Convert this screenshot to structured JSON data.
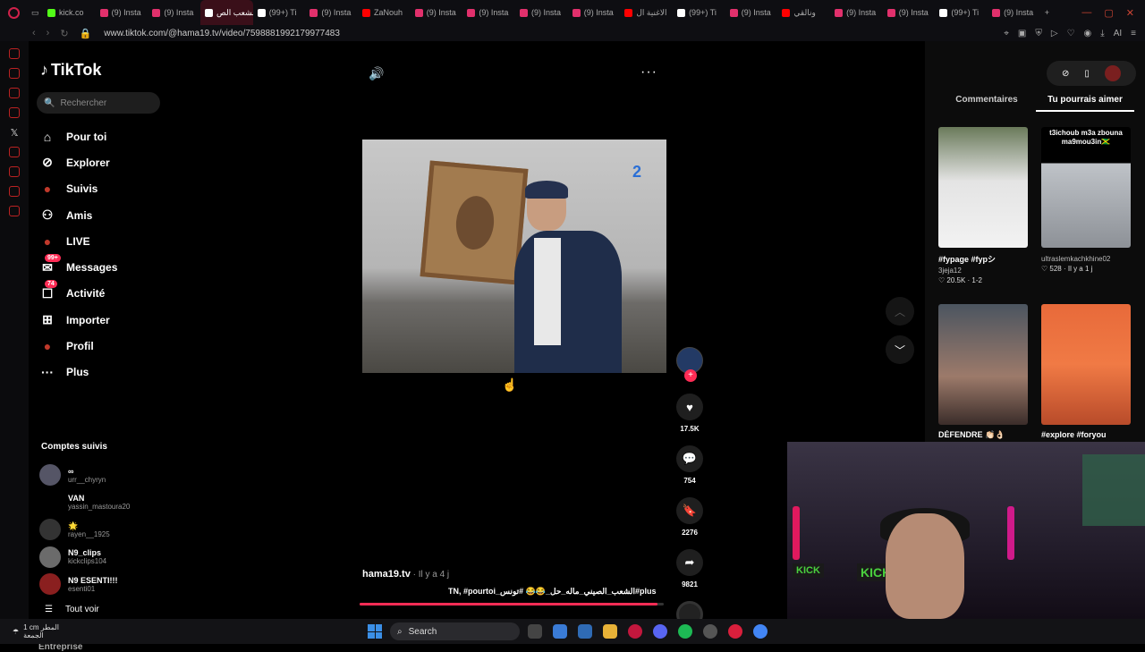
{
  "browser": {
    "tabs": [
      {
        "label": "kick.co",
        "color": "#53fc18"
      },
      {
        "label": "(9) Insta",
        "color": "#e1306c"
      },
      {
        "label": "(9) Insta",
        "color": "#e1306c"
      },
      {
        "label": "الشعب الص",
        "color": "#ffffff",
        "active": true
      },
      {
        "label": "(99+) Ti",
        "color": "#ffffff"
      },
      {
        "label": "(9) Insta",
        "color": "#e1306c"
      },
      {
        "label": "ZaNouh",
        "color": "#ff0000"
      },
      {
        "label": "(9) Insta",
        "color": "#e1306c"
      },
      {
        "label": "(9) Insta",
        "color": "#e1306c"
      },
      {
        "label": "(9) Insta",
        "color": "#e1306c"
      },
      {
        "label": "(9) Insta",
        "color": "#e1306c"
      },
      {
        "label": "الاغنية ال",
        "color": "#ff0000"
      },
      {
        "label": "(99+) Ti",
        "color": "#ffffff"
      },
      {
        "label": "(9) Insta",
        "color": "#e1306c"
      },
      {
        "label": "ونالقي",
        "color": "#ff0000"
      },
      {
        "label": "(9) Insta",
        "color": "#e1306c"
      },
      {
        "label": "(9) Insta",
        "color": "#e1306c"
      },
      {
        "label": "(99+) Ti",
        "color": "#ffffff"
      },
      {
        "label": "(9) Insta",
        "color": "#e1306c"
      }
    ],
    "url": "www.tiktok.com/@hama19.tv/video/7598881992179977483",
    "ai_label": "AI"
  },
  "tiktok": {
    "logo_text": "TikTok",
    "search_placeholder": "Rechercher",
    "menu": [
      {
        "label": "Pour toi",
        "icon": "home-icon"
      },
      {
        "label": "Explorer",
        "icon": "compass-icon"
      },
      {
        "label": "Suivis",
        "icon": "following-icon"
      },
      {
        "label": "Amis",
        "icon": "friends-icon"
      },
      {
        "label": "LIVE",
        "icon": "live-icon"
      },
      {
        "label": "Messages",
        "icon": "messages-icon",
        "badge": "99+"
      },
      {
        "label": "Activité",
        "icon": "activity-icon",
        "badge": "74"
      },
      {
        "label": "Importer",
        "icon": "upload-icon"
      },
      {
        "label": "Profil",
        "icon": "profile-icon"
      },
      {
        "label": "Plus",
        "icon": "more-icon"
      }
    ],
    "following_title": "Comptes suivis",
    "following": [
      {
        "name": "∞",
        "handle": "urr__chyryn"
      },
      {
        "name": "VAN",
        "handle": "yassin_mastoura20"
      },
      {
        "name": "🌟",
        "handle": "rayen__1925"
      },
      {
        "name": "N9_clips",
        "handle": "kickclips104"
      },
      {
        "name": "N9 ESENTI!!!",
        "handle": "esenti01"
      }
    ],
    "see_all": "Tout voir",
    "entreprise": "Entreprise",
    "video": {
      "author": "hama19.tv",
      "time": " · Il y a 4 j",
      "caption": "#الشعب_الصيني_ماله_حل_😂😂 #تونس_TN, #pourtoi",
      "more": "plus",
      "progress": 0.98,
      "likes": "17.5K",
      "comments": "754",
      "saves": "2276",
      "shares": "9821"
    },
    "panel": {
      "tabs": [
        "Commentaires",
        "Tu pourrais aimer"
      ],
      "active_tab": 1,
      "cards": [
        {
          "title": "#fypage #fypシ",
          "user": "3jeja12",
          "likes": "20.5K · 1-2",
          "overlay": ""
        },
        {
          "title": "",
          "user": "ultraslemkachkhine02",
          "likes": "528 · Il y a 1 j",
          "overlay": "t3ichoub m3a zbouna ma9mou3in🇯🇲"
        },
        {
          "title": "DÉFENDRE 👏🏻👌🏻",
          "user": "",
          "likes": "",
          "overlay": ""
        },
        {
          "title": "#explore #foryou",
          "user": "",
          "likes": "",
          "overlay": ""
        }
      ]
    }
  },
  "webcam": {
    "sign_left": "KICK",
    "sign_right": "KICK"
  },
  "taskbar": {
    "weather_temp": "1 cm",
    "weather_line1": "المطر",
    "weather_line2": "الجمعة",
    "search_label": "Search"
  }
}
